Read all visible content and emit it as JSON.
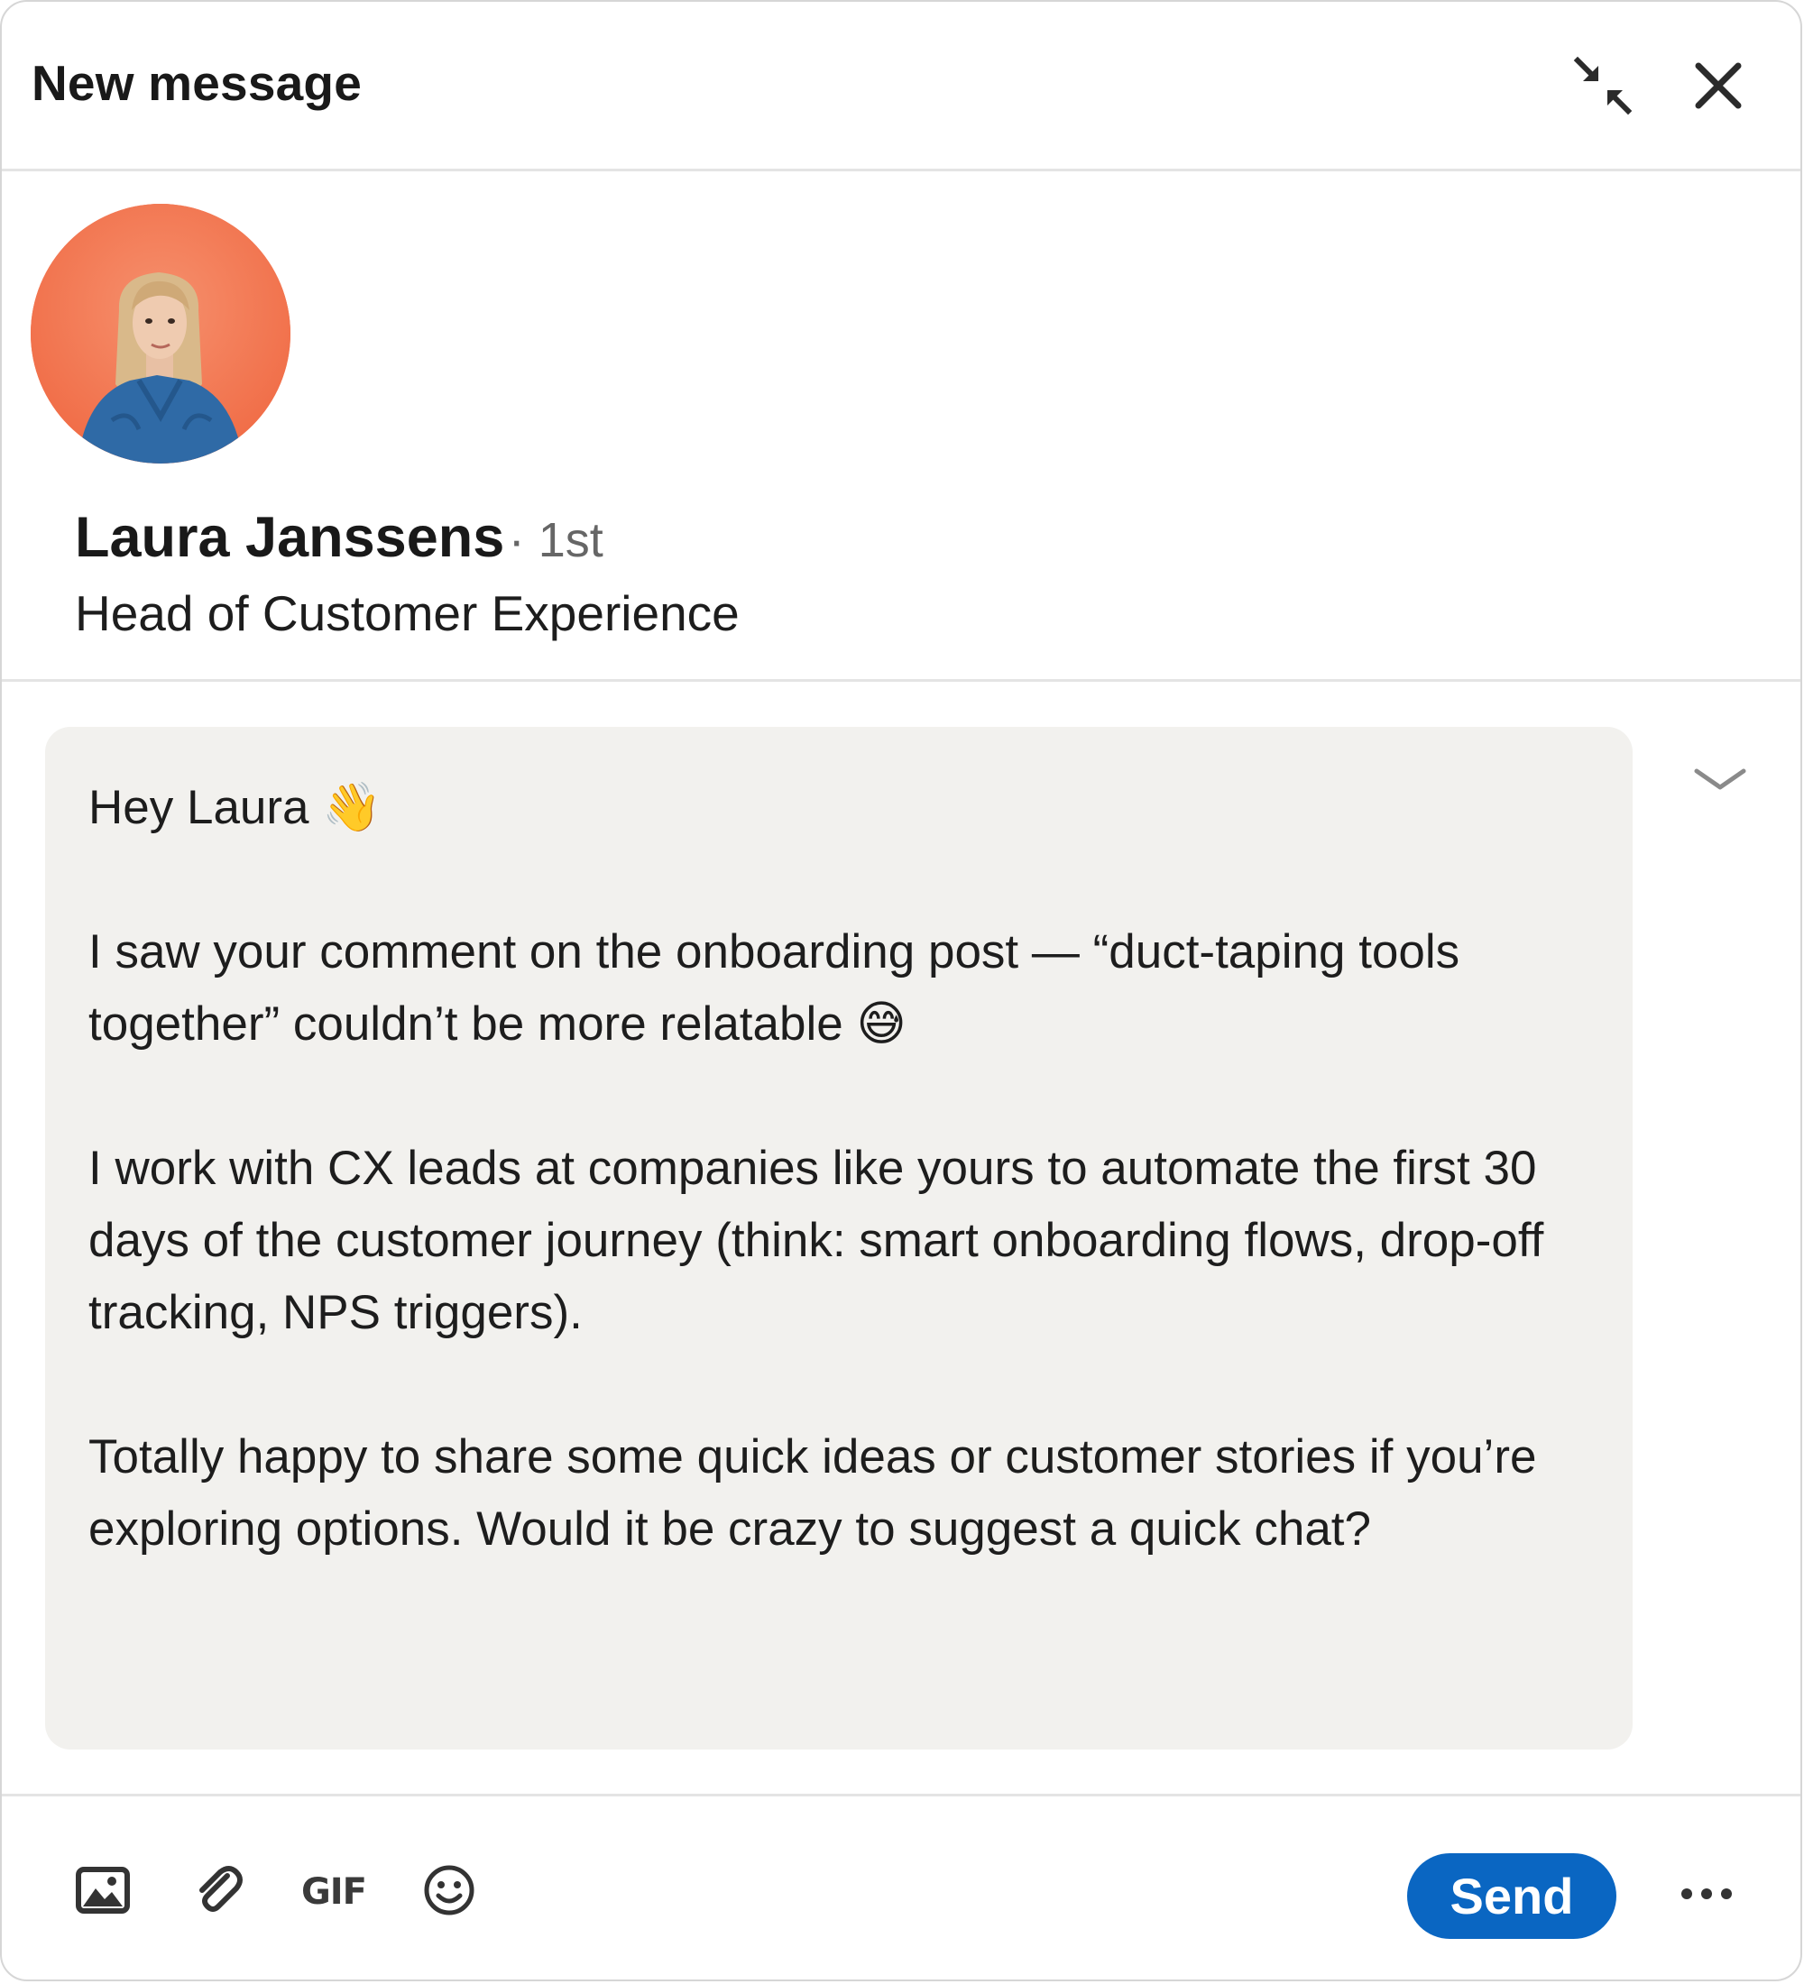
{
  "header": {
    "title": "New message",
    "minimize_icon": "minimize-arrows-icon",
    "close_icon": "close-icon"
  },
  "recipient": {
    "name": "Laura Janssens",
    "degree": "· 1st",
    "headline": "Head of Customer Experience",
    "avatar_bg": "#f47a55"
  },
  "message": {
    "paragraphs": [
      "Hey Laura 👋",
      "I saw your comment on the onboarding post — “duct-taping tools together” couldn’t be more relatable 😅",
      "I work with CX leads at companies like yours to automate the first 30 days of the customer journey (think: smart onboarding flows, drop-off tracking, NPS triggers).",
      "Totally happy to share some quick ideas or customer stories if you’re exploring options. Would it be crazy to suggest a quick chat?"
    ],
    "background": "#f2f1ee"
  },
  "toolbar": {
    "image_icon": "image-icon",
    "attach_icon": "paperclip-icon",
    "gif_label": "GIF",
    "emoji_icon": "smiley-icon",
    "send_label": "Send",
    "more_icon": "more-horizontal-icon",
    "send_color": "#0a66c2"
  }
}
